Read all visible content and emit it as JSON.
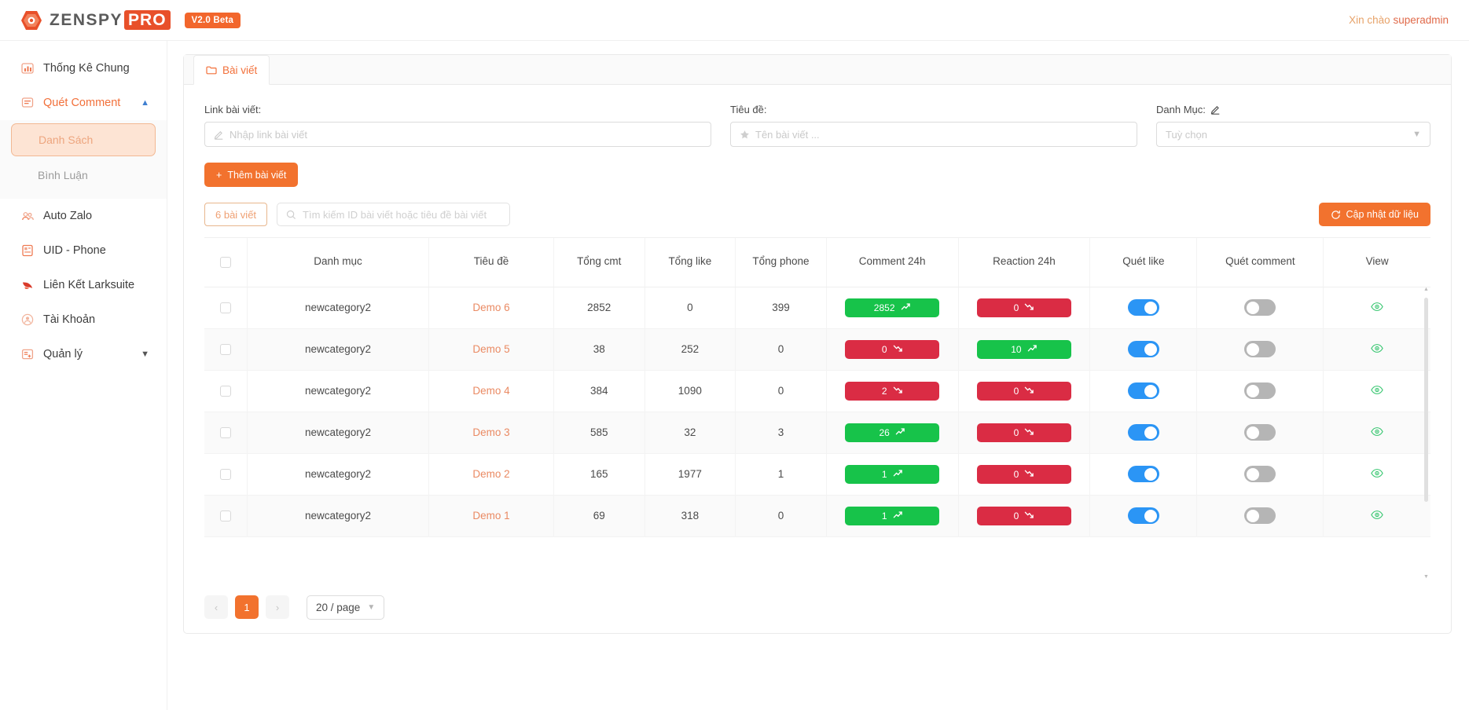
{
  "topbar": {
    "logo_text_1": "ZENSPY",
    "logo_text_2": "PRO",
    "version_badge": "V2.0 Beta",
    "greeting_prefix": "Xin chào ",
    "greeting_user": "superadmin",
    "logo_icon": "zenspy-logo-icon"
  },
  "sidebar": {
    "items": [
      {
        "label": "Thống Kê Chung",
        "icon": "chart-bar-icon",
        "accent": false,
        "caret": ""
      },
      {
        "label": "Quét Comment",
        "icon": "comment-scan-icon",
        "accent": true,
        "caret": "▲"
      },
      {
        "label": "Auto Zalo",
        "icon": "zalo-users-icon",
        "accent": false,
        "caret": ""
      },
      {
        "label": "UID - Phone",
        "icon": "id-card-icon",
        "accent": false,
        "caret": ""
      },
      {
        "label": "Liên Kết Larksuite",
        "icon": "link-bird-icon",
        "accent": false,
        "caret": ""
      },
      {
        "label": "Tài Khoản",
        "icon": "user-circle-icon",
        "accent": false,
        "caret": ""
      },
      {
        "label": "Quản lý",
        "icon": "manage-folder-icon",
        "accent": false,
        "caret": "▼"
      }
    ],
    "submenu": [
      {
        "label": "Danh Sách",
        "active": true
      },
      {
        "label": "Bình Luận",
        "active": false
      }
    ]
  },
  "tabs": [
    {
      "label": "Bài viết",
      "icon": "folder-icon",
      "active": true
    }
  ],
  "form": {
    "link_label": "Link bài viết:",
    "link_placeholder": "Nhập link bài viết",
    "link_value": "",
    "link_icon": "pencil-icon",
    "title_label": "Tiêu đề:",
    "title_placeholder": "Tên bài viết ...",
    "title_value": "",
    "title_icon": "star-icon",
    "category_label": "Danh Mục:",
    "category_edit_icon": "pencil-icon",
    "category_placeholder": "Tuỳ chọn",
    "category_value": "",
    "category_caret_icon": "chevron-down-icon",
    "add_button_label": "Thêm bài viết",
    "add_button_icon": "plus-icon"
  },
  "toolbar": {
    "count_label": "6 bài viết",
    "search_placeholder": "Tìm kiếm ID bài viết hoặc tiêu đề bài viết",
    "search_value": "",
    "search_icon": "search-icon",
    "refresh_label": "Cập nhật dữ liệu",
    "refresh_icon": "refresh-icon"
  },
  "table": {
    "columns": [
      "",
      "Danh mục",
      "Tiêu đề",
      "Tổng cmt",
      "Tổng like",
      "Tổng phone",
      "Comment 24h",
      "Reaction 24h",
      "Quét like",
      "Quét comment",
      "View"
    ],
    "rows": [
      {
        "category": "newcategory2",
        "title": "Demo 6",
        "total_cmt": "2852",
        "total_like": "0",
        "total_phone": "399",
        "comment_24h": {
          "value": "2852",
          "trend": "up"
        },
        "reaction_24h": {
          "value": "0",
          "trend": "down"
        },
        "scan_like": "on",
        "scan_comment": "off",
        "view_icon": "eye-icon"
      },
      {
        "category": "newcategory2",
        "title": "Demo 5",
        "total_cmt": "38",
        "total_like": "252",
        "total_phone": "0",
        "comment_24h": {
          "value": "0",
          "trend": "down"
        },
        "reaction_24h": {
          "value": "10",
          "trend": "up"
        },
        "scan_like": "on",
        "scan_comment": "off",
        "view_icon": "eye-icon"
      },
      {
        "category": "newcategory2",
        "title": "Demo 4",
        "total_cmt": "384",
        "total_like": "1090",
        "total_phone": "0",
        "comment_24h": {
          "value": "2",
          "trend": "down"
        },
        "reaction_24h": {
          "value": "0",
          "trend": "down"
        },
        "scan_like": "on",
        "scan_comment": "off",
        "view_icon": "eye-icon"
      },
      {
        "category": "newcategory2",
        "title": "Demo 3",
        "total_cmt": "585",
        "total_like": "32",
        "total_phone": "3",
        "comment_24h": {
          "value": "26",
          "trend": "up"
        },
        "reaction_24h": {
          "value": "0",
          "trend": "down"
        },
        "scan_like": "on",
        "scan_comment": "off",
        "view_icon": "eye-icon"
      },
      {
        "category": "newcategory2",
        "title": "Demo 2",
        "total_cmt": "165",
        "total_like": "1977",
        "total_phone": "1",
        "comment_24h": {
          "value": "1",
          "trend": "up"
        },
        "reaction_24h": {
          "value": "0",
          "trend": "down"
        },
        "scan_like": "on",
        "scan_comment": "off",
        "view_icon": "eye-icon"
      },
      {
        "category": "newcategory2",
        "title": "Demo 1",
        "total_cmt": "69",
        "total_like": "318",
        "total_phone": "0",
        "comment_24h": {
          "value": "1",
          "trend": "up"
        },
        "reaction_24h": {
          "value": "0",
          "trend": "down"
        },
        "scan_like": "on",
        "scan_comment": "off",
        "view_icon": "eye-icon"
      }
    ]
  },
  "pagination": {
    "prev": "‹",
    "pages": [
      "1"
    ],
    "current": "1",
    "next": "›",
    "page_size": "20 / page",
    "page_size_caret": "chevron-down-icon"
  },
  "colors": {
    "accent": "#f2722e",
    "up": "#17c34a",
    "down": "#da2c44",
    "toggle_on": "#2b95f5",
    "toggle_off": "#b5b5b5",
    "eye": "#2fc46a"
  }
}
